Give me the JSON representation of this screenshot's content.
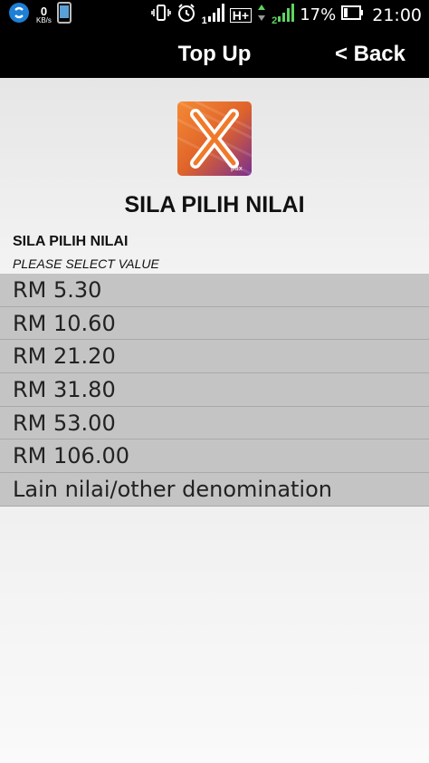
{
  "status_bar": {
    "speed_value": "0",
    "speed_unit": "KB/s",
    "sim1_label": "1",
    "network_type": "H+",
    "sim2_label": "2",
    "battery_percent": "17%",
    "clock": "21:00",
    "icons": [
      "sync-icon",
      "phone-icon",
      "vibrate-icon",
      "alarm-icon",
      "signal-icon",
      "data-arrows-icon",
      "battery-icon"
    ]
  },
  "app_bar": {
    "title": "Top Up",
    "back_label": "< Back"
  },
  "header": {
    "logo_text": "pax",
    "title": "SILA PILIH NILAI",
    "subtitle": "SILA PILIH NILAI",
    "subtitle_en": "PLEASE SELECT VALUE"
  },
  "options": [
    {
      "label": "RM 5.30"
    },
    {
      "label": "RM 10.60"
    },
    {
      "label": "RM 21.20"
    },
    {
      "label": "RM 31.80"
    },
    {
      "label": "RM 53.00"
    },
    {
      "label": "RM 106.00"
    },
    {
      "label": "Lain nilai/other denomination"
    }
  ],
  "colors": {
    "bar_bg": "#000000",
    "option_bg": "#c4c4c4",
    "logo_orange": "#f07a2a",
    "logo_purple": "#7a2f8f"
  }
}
